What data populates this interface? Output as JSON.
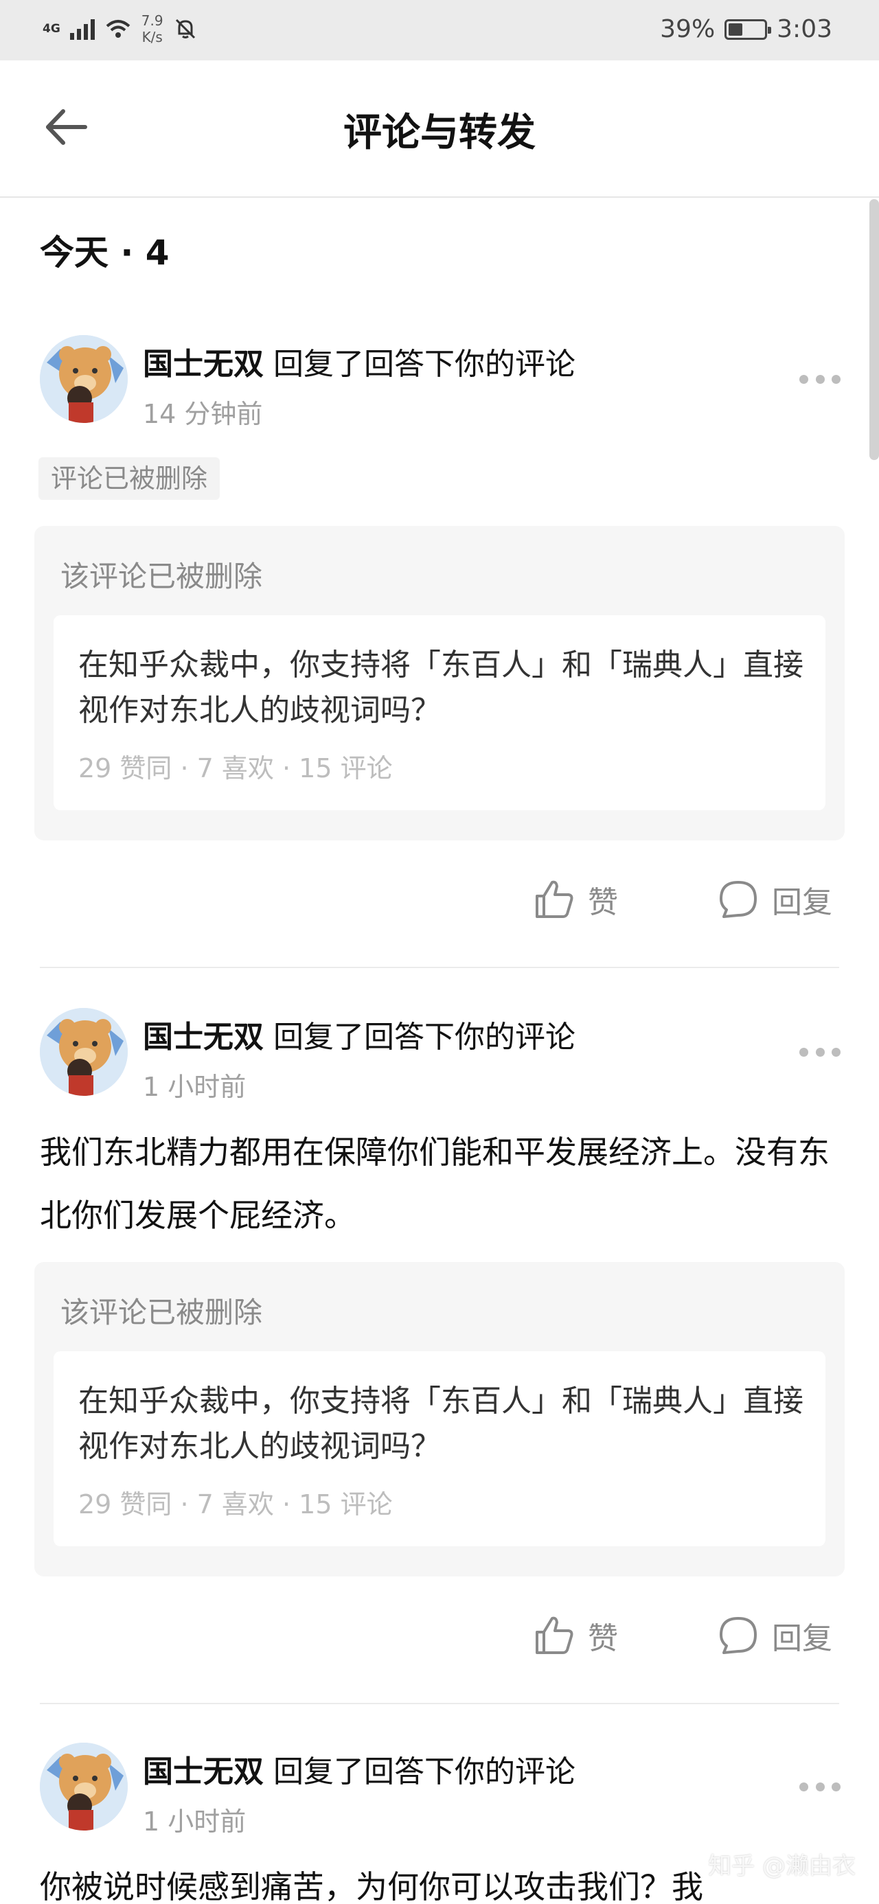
{
  "status_bar": {
    "network": "4G",
    "speed_value": "7.9",
    "speed_unit": "K/s",
    "battery_percent": "39%",
    "battery_level": 0.39,
    "time": "3:03"
  },
  "header": {
    "title": "评论与转发",
    "back_icon": "arrow-left-icon"
  },
  "section": {
    "title": "今天 · 4"
  },
  "notifications": [
    {
      "user": "国士无双",
      "action": " 回复了回答下你的评论",
      "time": "14 分钟前",
      "tag": "评论已被删除",
      "body": "",
      "quote_header": "该评论已被删除",
      "question": "在知乎众裁中，你支持将「东百人」和「瑞典人」直接视作对东北人的歧视词吗？",
      "stats": "29 赞同 · 7 喜欢 · 15 评论",
      "like_label": "赞",
      "reply_label": "回复"
    },
    {
      "user": "国士无双",
      "action": " 回复了回答下你的评论",
      "time": "1 小时前",
      "tag": "",
      "body": "我们东北精力都用在保障你们能和平发展经济上。没有东北你们发展个屁经济。",
      "quote_header": "该评论已被删除",
      "question": "在知乎众裁中，你支持将「东百人」和「瑞典人」直接视作对东北人的歧视词吗？",
      "stats": "29 赞同 · 7 喜欢 · 15 评论",
      "like_label": "赞",
      "reply_label": "回复"
    },
    {
      "user": "国士无双",
      "action": " 回复了回答下你的评论",
      "time": "1 小时前",
      "body": "你被说时候感到痛苦，为何你可以攻击我们？我"
    }
  ],
  "watermark": "知乎 @濑由衣",
  "colors": {
    "status_bar_bg": "#ebebeb",
    "muted_text": "#8a8a8a",
    "quote_bg": "#f6f6f6"
  }
}
